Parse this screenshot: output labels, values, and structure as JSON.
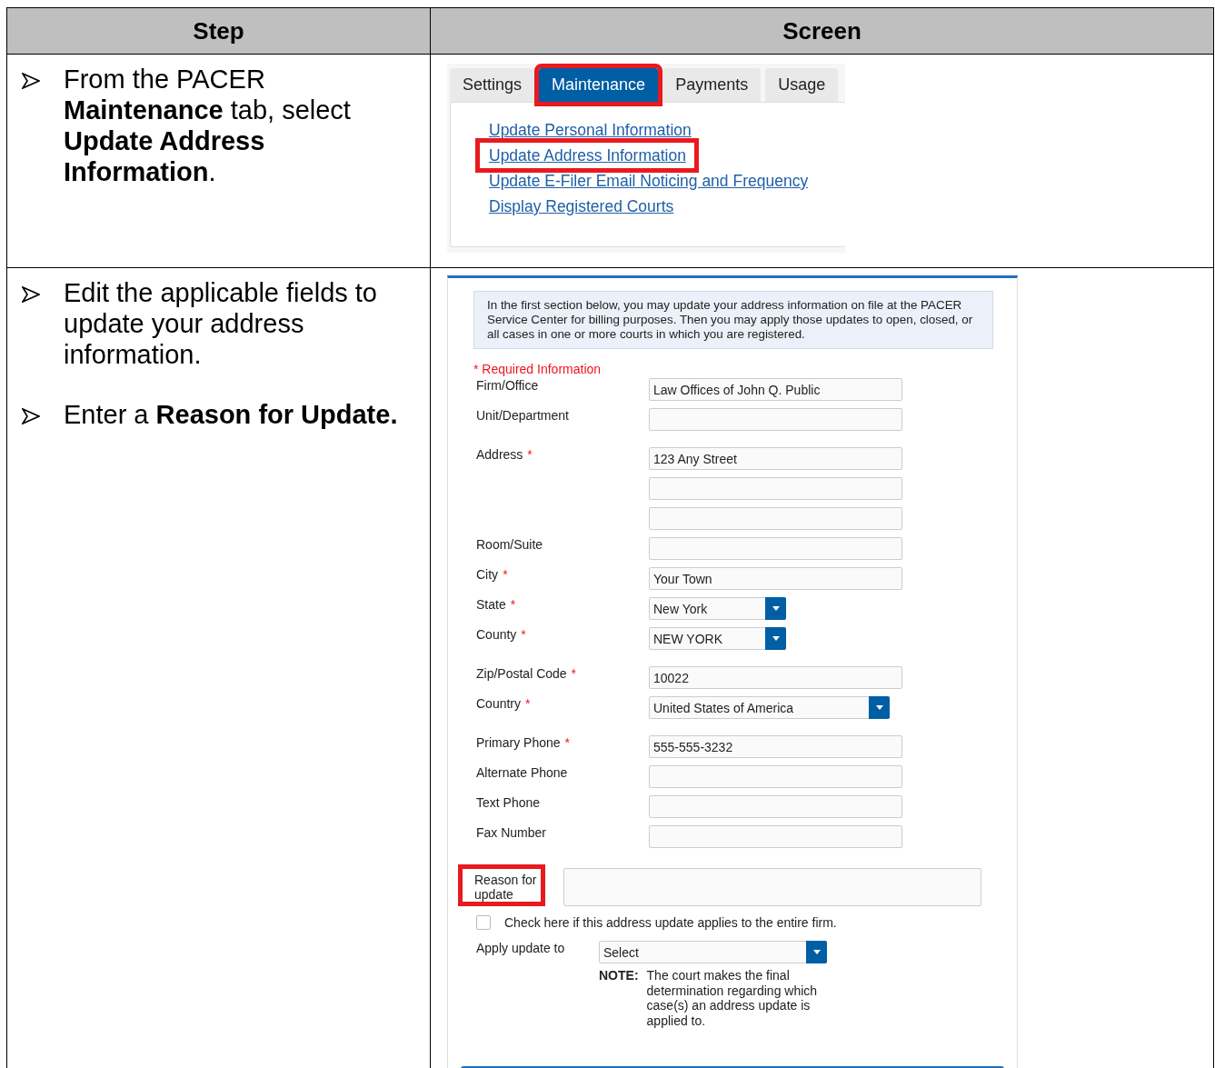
{
  "table": {
    "columns": [
      "Step",
      "Screen"
    ],
    "rows": [
      {
        "steps": [
          "From the PACER **Maintenance** tab, select **Update Address Information**."
        ],
        "screen": {
          "kind": "menu",
          "tabs": [
            {
              "label": "Settings",
              "selected": false,
              "highlighted": false
            },
            {
              "label": "Maintenance",
              "selected": true,
              "highlighted": true
            },
            {
              "label": "Payments",
              "selected": false,
              "highlighted": false
            },
            {
              "label": "Usage",
              "selected": false,
              "highlighted": false
            }
          ],
          "links": [
            {
              "text": "Update Personal Information",
              "highlighted": false
            },
            {
              "text": "Update Address Information",
              "highlighted": true
            },
            {
              "text": "Update E-Filer Email Noticing and Frequency",
              "highlighted": false
            },
            {
              "text": "Display Registered Courts",
              "highlighted": false
            }
          ]
        }
      },
      {
        "steps": [
          "Edit the applicable fields to update your address information.",
          "Enter a **Reason for Update.**"
        ],
        "screen": {
          "kind": "form",
          "intro": "In the first section below, you may update your address information on file at the PACER Service Center for billing purposes. Then you may apply those updates to open, closed, or all cases in one or more courts in which you are registered.",
          "required_note": "* Required Information",
          "groups": [
            {
              "fields": [
                {
                  "kind": "text",
                  "label": "Firm/Office",
                  "value": "Law Offices of John Q. Public"
                },
                {
                  "kind": "text",
                  "label": "Unit/Department"
                }
              ]
            },
            {
              "fields": [
                {
                  "kind": "text",
                  "label": "Address",
                  "required_mark": "*",
                  "value": "123 Any Street"
                },
                {
                  "kind": "text"
                },
                {
                  "kind": "text"
                },
                {
                  "kind": "text",
                  "label": "Room/Suite"
                },
                {
                  "kind": "text",
                  "label": "City",
                  "required_mark": "*",
                  "value": "Your Town"
                },
                {
                  "kind": "select",
                  "label": "State",
                  "required_mark": "*",
                  "value": "New York"
                },
                {
                  "kind": "select",
                  "label": "County",
                  "required_mark": "*",
                  "value": "NEW YORK"
                }
              ]
            },
            {
              "fields": [
                {
                  "kind": "text",
                  "label": "Zip/Postal Code",
                  "required_mark": "*",
                  "value": "10022"
                },
                {
                  "kind": "long-select",
                  "label": "Country",
                  "required_mark": "*",
                  "value": "United States of America"
                }
              ]
            },
            {
              "fields": [
                {
                  "kind": "text",
                  "label": "Primary Phone",
                  "required_mark": "*",
                  "value": "555-555-3232"
                },
                {
                  "kind": "text",
                  "label": "Alternate Phone"
                },
                {
                  "kind": "text",
                  "label": "Text Phone"
                },
                {
                  "kind": "text",
                  "label": "Fax Number"
                }
              ]
            }
          ],
          "reason": {
            "label": "Reason for update",
            "highlighted": true
          },
          "firm_checkbox": {
            "label": "Check here if this address update applies to the entire firm.",
            "checked": false
          },
          "apply": {
            "label": "Apply update to",
            "value": "Select",
            "note_label": "NOTE:",
            "note": "The court makes the final determination regarding which case(s) an address update is applied to."
          }
        }
      }
    ]
  }
}
